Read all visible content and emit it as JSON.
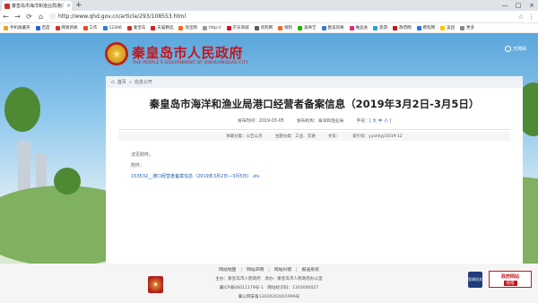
{
  "browser": {
    "tab_title": "秦皇岛市海洋和渔业局港口经…",
    "tab_close": "×",
    "new_tab": "+",
    "window_controls": [
      "—",
      "□",
      "×"
    ],
    "nav_buttons": [
      "←",
      "→",
      "⟳",
      "⌂"
    ],
    "url": "http://www.qhd.gov.cn/article/293/108553.html",
    "bookmarks": [
      {
        "label": "手机收藏夹",
        "color": "#f0a020"
      },
      {
        "label": "百度",
        "color": "#2b60d8"
      },
      {
        "label": "网易新闻",
        "color": "#d43030"
      },
      {
        "label": "工作",
        "color": "#e05020"
      },
      {
        "label": "12306",
        "color": "#2a80d0"
      },
      {
        "label": "秦皇岛",
        "color": "#c83030"
      },
      {
        "label": "天猫精选",
        "color": "#d02020"
      },
      {
        "label": "淘宝网",
        "color": "#f26b1d"
      },
      {
        "label": "http://",
        "color": "#999999"
      },
      {
        "label": "京东商城",
        "color": "#c81623"
      },
      {
        "label": "优购网",
        "color": "#5a5a5a"
      },
      {
        "label": "搜狗",
        "color": "#f06a30"
      },
      {
        "label": "爱奇艺",
        "color": "#1fb600"
      },
      {
        "label": "欧美风格",
        "color": "#3a7ad0"
      },
      {
        "label": "唯品会",
        "color": "#e0287a"
      },
      {
        "label": "旅游",
        "color": "#30a0d0"
      },
      {
        "label": "政府网",
        "color": "#c4161c"
      },
      {
        "label": "携程网",
        "color": "#2577e3"
      },
      {
        "label": "美团",
        "color": "#ffc300"
      },
      {
        "label": "更多",
        "color": "#888888"
      }
    ]
  },
  "site": {
    "title": "秦皇岛市人民政府",
    "subtitle": "THE PEOPLE'S GOVERNMENT OF QINHUANGDAO CITY",
    "accessibility": "无障碍"
  },
  "breadcrumb": {
    "home": "首页",
    "sep": "»",
    "section": "信息公开"
  },
  "article": {
    "title": "秦皇岛市海洋和渔业局港口经营者备案信息（2019年3月2日-3月5日）",
    "publish_time": "发布时间：2019-03-05",
    "publisher": "发布机构：海洋和渔业局",
    "font_size_label": "字号：[",
    "font_size_large": "大",
    "font_size_mid": "中",
    "font_size_small": "小",
    "font_size_end": "]",
    "category": "体裁分类：公告公示",
    "topic": "主题分类：工业、交通",
    "doc_no": "文号：",
    "index_no": "索引号：yyshhyj/2019-12",
    "body_line1": "详见附件。",
    "attachment_label": "附件：",
    "attachment_link": "153532__港口经营者备案信息（2019年3月2日—3月5日）.xls"
  },
  "footer": {
    "links": [
      "网站地图",
      "网站声明",
      "网站纠错",
      "报送系统"
    ],
    "line1": "主办：秦皇岛市人民政府　承办：秦皇岛市人民政府办公室",
    "line2": "冀ICP备06011179号-1　网站标识码：1303000027",
    "line3": "冀公网安备13030202001996号",
    "gov_badge_text": "党政机关",
    "error_badge_title": "政府网站",
    "error_badge_sub": "找错"
  },
  "colors": {
    "brand_red": "#c4161c",
    "link_blue": "#1f5ea8"
  }
}
